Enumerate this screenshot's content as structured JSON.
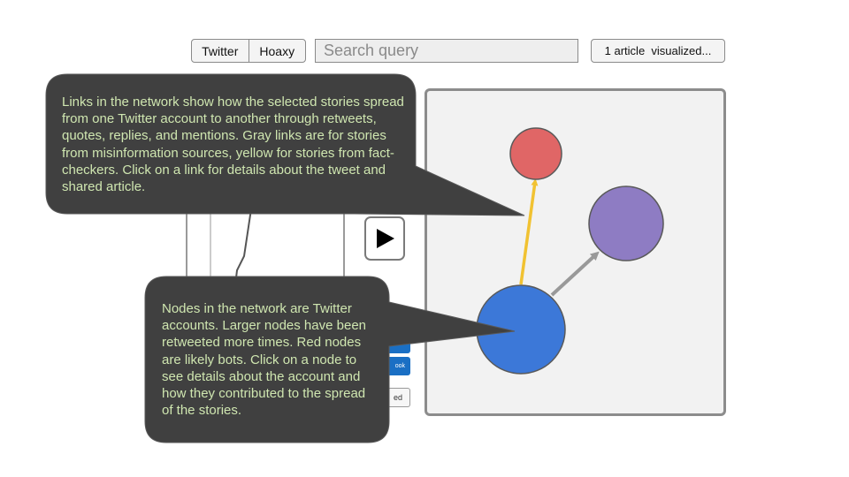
{
  "toolbar": {
    "tabs": [
      {
        "label": "Twitter"
      },
      {
        "label": "Hoaxy"
      }
    ],
    "search_placeholder": "Search query",
    "status_label": "1 article  visualized..."
  },
  "timeline": {
    "buttons": [
      {
        "label": "ook",
        "style": "primary"
      },
      {
        "label": "ed",
        "style": "secondary"
      }
    ]
  },
  "graph": {
    "nodes": [
      {
        "id": "red",
        "color": "#e06666",
        "bot": true
      },
      {
        "id": "purple",
        "color": "#8e7cc3",
        "bot": false
      },
      {
        "id": "blue",
        "color": "#3c78d8",
        "bot": false
      }
    ],
    "edges": [
      {
        "from": "blue",
        "to": "red",
        "color": "#f1c232",
        "type": "fact-checker"
      },
      {
        "from": "blue",
        "to": "purple",
        "color": "#999999",
        "type": "misinformation"
      }
    ]
  },
  "callouts": {
    "links": "Links in the network show how the selected stories spread from one Twitter account to another through retweets, quotes, replies, and mentions.  Gray links are for stories from misinformation sources, yellow for stories from fact-checkers.  Click on a link for details about the tweet and shared article.",
    "nodes": "Nodes in the network are Twitter accounts.  Larger nodes have been retweeted more times. Red nodes are likely bots. Click on a node to see details about the account and how they contributed to the spread of the stories."
  },
  "colors": {
    "callout_bg": "#404040",
    "callout_text": "#cfe6b0",
    "primary_button": "#1a6fc4"
  }
}
